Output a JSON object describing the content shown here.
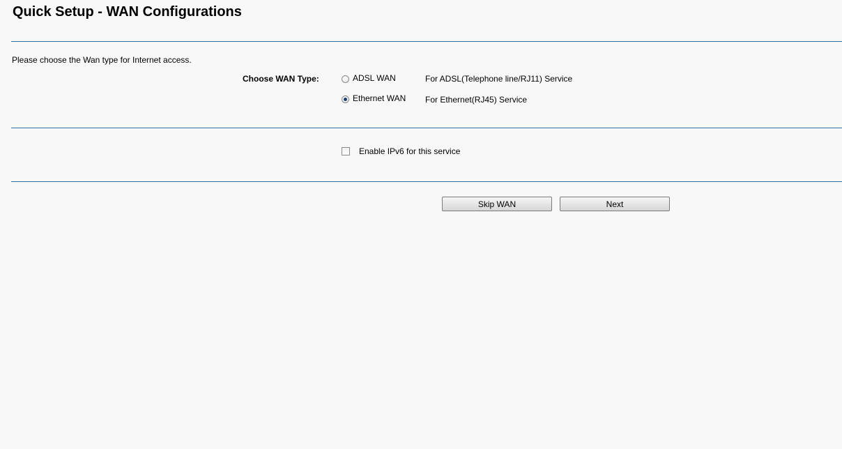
{
  "page": {
    "title": "Quick Setup - WAN Configurations",
    "intro": "Please choose the Wan type for Internet access."
  },
  "wan": {
    "label": "Choose WAN Type:",
    "options": [
      {
        "label": "ADSL WAN",
        "description": "For ADSL(Telephone line/RJ11) Service",
        "selected": false
      },
      {
        "label": "Ethernet WAN",
        "description": "For Ethernet(RJ45) Service",
        "selected": true
      }
    ]
  },
  "ipv6": {
    "label": "Enable IPv6 for this service",
    "checked": false
  },
  "buttons": {
    "skip": "Skip WAN",
    "next": "Next"
  },
  "colors": {
    "divider": "#2f6fa8",
    "background": "#f8f8f8"
  }
}
